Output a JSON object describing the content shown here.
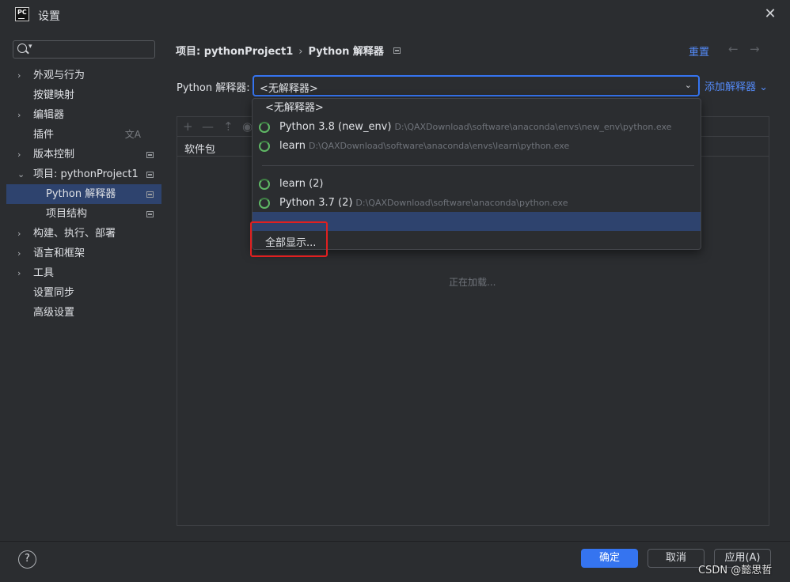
{
  "window": {
    "logo_text": "PC",
    "title": "设置",
    "close_glyph": "✕"
  },
  "sidebar": {
    "items": [
      {
        "label": "外观与行为",
        "expandable": true
      },
      {
        "label": "按键映射",
        "expandable": false
      },
      {
        "label": "编辑器",
        "expandable": true
      },
      {
        "label": "插件",
        "expandable": false,
        "trailing_icon": "translate-icon"
      },
      {
        "label": "版本控制",
        "expandable": true,
        "trailing_icon": "page-icon"
      },
      {
        "label": "项目: pythonProject1",
        "expandable": true,
        "expanded": true,
        "trailing_icon": "page-icon"
      },
      {
        "label": "Python 解释器",
        "child": true,
        "selected": true,
        "trailing_icon": "page-icon"
      },
      {
        "label": "项目结构",
        "child": true,
        "trailing_icon": "page-icon"
      },
      {
        "label": "构建、执行、部署",
        "expandable": true
      },
      {
        "label": "语言和框架",
        "expandable": true
      },
      {
        "label": "工具",
        "expandable": true
      },
      {
        "label": "设置同步",
        "expandable": false
      },
      {
        "label": "高级设置",
        "expandable": false
      }
    ]
  },
  "header": {
    "breadcrumb_project": "项目: pythonProject1",
    "breadcrumb_sep": "›",
    "breadcrumb_page": "Python 解释器",
    "reset_label": "重置",
    "back_glyph": "←",
    "forward_glyph": "→"
  },
  "interpreter": {
    "label": "Python 解释器:",
    "selected_value": "<无解释器>",
    "add_label": "添加解释器 ⌄"
  },
  "packages": {
    "column_header": "软件包",
    "loading_text": "正在加载..."
  },
  "dropdown": {
    "no_interpreter": "<无解释器>",
    "options": [
      {
        "name": "Python 3.8 (new_env)",
        "path": "D:\\QAXDownload\\software\\anaconda\\envs\\new_env\\python.exe"
      },
      {
        "name": "learn",
        "path": "D:\\QAXDownload\\software\\anaconda\\envs\\learn\\python.exe"
      },
      {
        "name": "learn (2)",
        "path": ""
      },
      {
        "name": "Python 3.7 (2)",
        "path": "D:\\QAXDownload\\software\\anaconda\\python.exe"
      }
    ],
    "show_all": "全部显示..."
  },
  "footer": {
    "help": "?",
    "ok": "确定",
    "cancel": "取消",
    "apply": "应用(A)",
    "watermark": "CSDN @懿思哲"
  },
  "colors": {
    "accent": "#3574f0",
    "link": "#548af7",
    "selection": "#2e436e",
    "highlight_box": "#e02020",
    "python_icon": "#5fb865"
  }
}
